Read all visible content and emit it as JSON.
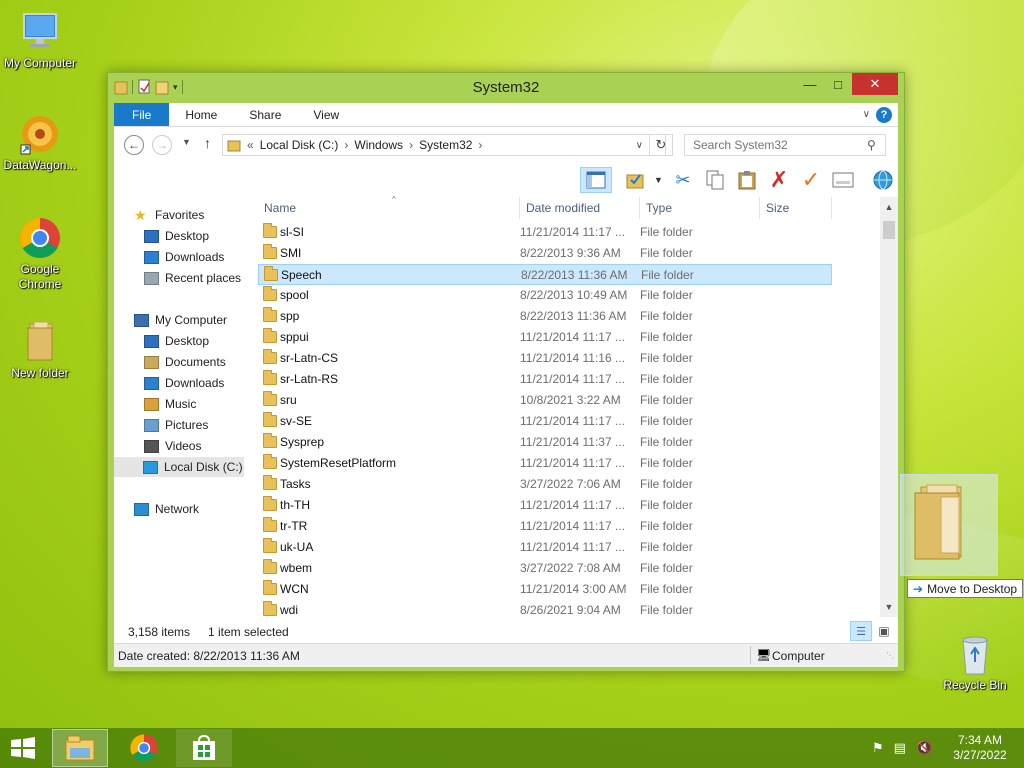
{
  "desktop": {
    "icons": [
      {
        "label": "My Computer"
      },
      {
        "label": "DataWagon..."
      },
      {
        "label": "Google Chrome"
      },
      {
        "label": "New folder"
      },
      {
        "label": "Recycle Bin"
      }
    ]
  },
  "window": {
    "title": "System32",
    "ribbon_tabs": [
      "File",
      "Home",
      "Share",
      "View"
    ],
    "address": {
      "prefix": "«",
      "crumbs": [
        "Local Disk (C:)",
        "Windows",
        "System32"
      ]
    },
    "search_placeholder": "Search System32",
    "nav": {
      "favorites_label": "Favorites",
      "favorites": [
        "Desktop",
        "Downloads",
        "Recent places"
      ],
      "computer_label": "My Computer",
      "computer": [
        "Desktop",
        "Documents",
        "Downloads",
        "Music",
        "Pictures",
        "Videos",
        "Local Disk (C:)"
      ],
      "network_label": "Network"
    },
    "columns": {
      "name": "Name",
      "date": "Date modified",
      "type": "Type",
      "size": "Size"
    },
    "files": [
      {
        "name": "sl-SI",
        "date": "11/21/2014 11:17 ...",
        "type": "File folder"
      },
      {
        "name": "SMI",
        "date": "8/22/2013 9:36 AM",
        "type": "File folder"
      },
      {
        "name": "Speech",
        "date": "8/22/2013 11:36 AM",
        "type": "File folder"
      },
      {
        "name": "spool",
        "date": "8/22/2013 10:49 AM",
        "type": "File folder"
      },
      {
        "name": "spp",
        "date": "8/22/2013 11:36 AM",
        "type": "File folder"
      },
      {
        "name": "sppui",
        "date": "11/21/2014 11:17 ...",
        "type": "File folder"
      },
      {
        "name": "sr-Latn-CS",
        "date": "11/21/2014 11:16 ...",
        "type": "File folder"
      },
      {
        "name": "sr-Latn-RS",
        "date": "11/21/2014 11:17 ...",
        "type": "File folder"
      },
      {
        "name": "sru",
        "date": "10/8/2021 3:22 AM",
        "type": "File folder"
      },
      {
        "name": "sv-SE",
        "date": "11/21/2014 11:17 ...",
        "type": "File folder"
      },
      {
        "name": "Sysprep",
        "date": "11/21/2014 11:37 ...",
        "type": "File folder"
      },
      {
        "name": "SystemResetPlatform",
        "date": "11/21/2014 11:17 ...",
        "type": "File folder"
      },
      {
        "name": "Tasks",
        "date": "3/27/2022 7:06 AM",
        "type": "File folder"
      },
      {
        "name": "th-TH",
        "date": "11/21/2014 11:17 ...",
        "type": "File folder"
      },
      {
        "name": "tr-TR",
        "date": "11/21/2014 11:17 ...",
        "type": "File folder"
      },
      {
        "name": "uk-UA",
        "date": "11/21/2014 11:17 ...",
        "type": "File folder"
      },
      {
        "name": "wbem",
        "date": "3/27/2022 7:08 AM",
        "type": "File folder"
      },
      {
        "name": "WCN",
        "date": "11/21/2014 3:00 AM",
        "type": "File folder"
      },
      {
        "name": "wdi",
        "date": "8/26/2021 9:04 AM",
        "type": "File folder"
      }
    ],
    "selected_file": "Speech",
    "status": {
      "items": "3,158 items",
      "selected": "1 item selected"
    },
    "details": {
      "created": "Date created: 8/22/2013 11:36 AM",
      "location": "Computer"
    }
  },
  "drag": {
    "tooltip": "Move to Desktop"
  },
  "taskbar": {
    "time": "7:34 AM",
    "date": "3/27/2022"
  },
  "colors": {
    "accent": "#1979ca",
    "selection": "#cce8ff",
    "window_frame": "#a9d255",
    "close": "#c7312e"
  }
}
